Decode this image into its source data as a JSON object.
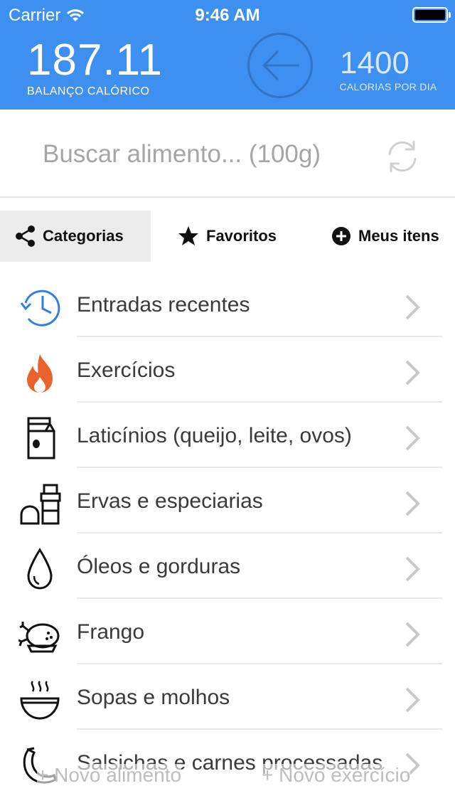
{
  "status_bar": {
    "carrier": "Carrier",
    "time": "9:46 AM"
  },
  "header": {
    "balance_value": "187.11",
    "balance_label": "BALANÇO CALÓRICO",
    "daily_value": "1400",
    "daily_label": "CALORIAS POR DIA"
  },
  "search": {
    "placeholder": "Buscar alimento... (100g)"
  },
  "tabs": [
    {
      "label": "Categorias",
      "icon": "share-icon",
      "active": true
    },
    {
      "label": "Favoritos",
      "icon": "star-icon",
      "active": false
    },
    {
      "label": "Meus itens",
      "icon": "plus-circle-icon",
      "active": false
    }
  ],
  "categories": [
    {
      "label": "Entradas recentes",
      "icon": "clock-history-icon"
    },
    {
      "label": "Exercícios",
      "icon": "flame-icon"
    },
    {
      "label": "Laticínios (queijo, leite, ovos)",
      "icon": "milk-carton-icon"
    },
    {
      "label": "Ervas e especiarias",
      "icon": "spice-shaker-icon"
    },
    {
      "label": "Óleos e gorduras",
      "icon": "oil-drop-icon"
    },
    {
      "label": "Frango",
      "icon": "roast-chicken-icon"
    },
    {
      "label": "Sopas e molhos",
      "icon": "soup-bowl-icon"
    },
    {
      "label": "Salsichas e carnes processadas",
      "icon": "sausage-icon"
    }
  ],
  "bottom": {
    "new_food": "+ Novo alimento",
    "new_exercise": "+ Novo exercício"
  },
  "colors": {
    "header_bg": "#3d8ff0",
    "flame": "#e8642c",
    "clock": "#2f7fe0"
  }
}
